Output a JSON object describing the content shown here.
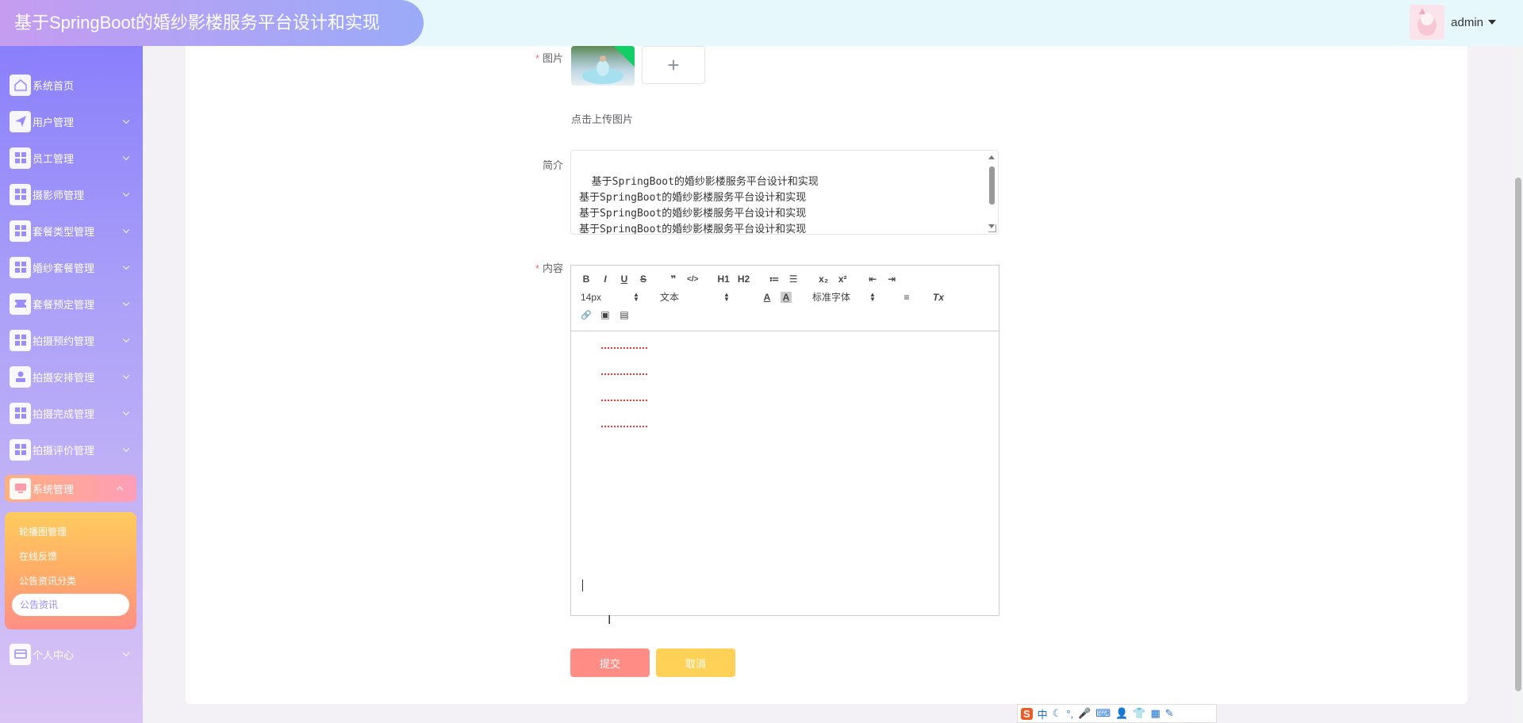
{
  "header": {
    "title": "基于SpringBoot的婚纱影楼服务平台设计和实现",
    "username": "admin"
  },
  "sidebar": {
    "items": [
      {
        "label": "系统首页",
        "icon": "home-icon"
      },
      {
        "label": "用户管理",
        "icon": "paper-plane-icon"
      },
      {
        "label": "员工管理",
        "icon": "grid-icon"
      },
      {
        "label": "摄影师管理",
        "icon": "grid-icon"
      },
      {
        "label": "套餐类型管理",
        "icon": "grid-icon"
      },
      {
        "label": "婚纱套餐管理",
        "icon": "grid-icon"
      },
      {
        "label": "套餐预定管理",
        "icon": "ticket-icon"
      },
      {
        "label": "拍摄预约管理",
        "icon": "grid-icon"
      },
      {
        "label": "拍摄安排管理",
        "icon": "user-icon"
      },
      {
        "label": "拍摄完成管理",
        "icon": "grid-icon"
      },
      {
        "label": "拍摄评价管理",
        "icon": "grid-icon"
      },
      {
        "label": "系统管理",
        "icon": "monitor-icon"
      },
      {
        "label": "个人中心",
        "icon": "card-icon"
      }
    ],
    "submenu": [
      "轮播图管理",
      "在线反馈",
      "公告资讯分类",
      "公告资讯"
    ]
  },
  "form": {
    "image_label": "图片",
    "upload_tip": "点击上传图片",
    "intro_label": "简介",
    "intro_value": "基于SpringBoot的婚纱影楼服务平台设计和实现\n基于SpringBoot的婚纱影楼服务平台设计和实现\n基于SpringBoot的婚纱影楼服务平台设计和实现\n基于SpringBoot的婚纱影楼服务平台设计和实现",
    "content_label": "内容",
    "submit": "提交",
    "cancel": "取消"
  },
  "editor": {
    "row1": [
      "B",
      "I",
      "U",
      "S",
      "❞",
      "</>",
      "H1",
      "H2",
      "≔",
      "☰",
      "x₂",
      "x²",
      "⇤",
      "⇥"
    ],
    "font_size": "14px",
    "block": "文本",
    "font_family": "标准字体",
    "row2_icons": [
      "A",
      "A̲",
      "≡",
      "Tx"
    ],
    "row3_icons": [
      "🔗",
      "▣",
      "▤"
    ]
  },
  "ime": {
    "logo": "S",
    "mode": "中"
  },
  "colors": {
    "submit": "#ff8c85",
    "cancel": "#ffd257",
    "sidebar_top": "#8a7ffb",
    "active_menu": "#ff9db8"
  }
}
